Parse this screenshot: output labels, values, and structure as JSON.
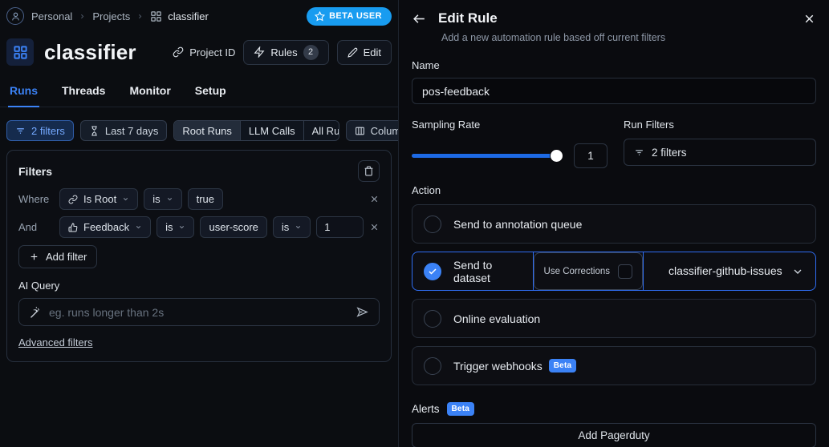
{
  "breadcrumb": {
    "personal": "Personal",
    "projects": "Projects",
    "project": "classifier",
    "beta_badge": "BETA USER"
  },
  "header": {
    "title": "classifier",
    "project_id": "Project ID",
    "rules": "Rules",
    "rules_count": "2",
    "edit": "Edit"
  },
  "tabs": {
    "runs": "Runs",
    "threads": "Threads",
    "monitor": "Monitor",
    "setup": "Setup"
  },
  "toolbar": {
    "filters": "2 filters",
    "date_range": "Last 7 days",
    "seg_root": "Root Runs",
    "seg_llm": "LLM Calls",
    "seg_all": "All Runs",
    "columns": "Columns"
  },
  "filters_panel": {
    "title": "Filters",
    "row1": {
      "conjunction": "Where",
      "field": "Is Root",
      "op": "is",
      "value": "true"
    },
    "row2": {
      "conjunction": "And",
      "field": "Feedback",
      "op1": "is",
      "key": "user-score",
      "op2": "is",
      "value": "1"
    },
    "add_filter": "Add filter",
    "ai_query_label": "AI Query",
    "ai_query_placeholder": "eg. runs longer than 2s",
    "advanced_filters": "Advanced filters"
  },
  "drawer": {
    "title": "Edit Rule",
    "subtitle": "Add a new automation rule based off current filters",
    "name_label": "Name",
    "name_value": "pos-feedback",
    "sampling_rate_label": "Sampling Rate",
    "sampling_rate_value": "1",
    "run_filters_label": "Run Filters",
    "run_filters_value": "2 filters",
    "action_label": "Action",
    "options": {
      "annotation": "Send to annotation queue",
      "dataset": "Send to dataset",
      "use_corrections": "Use Corrections",
      "dataset_value": "classifier-github-issues",
      "online_eval": "Online evaluation",
      "webhooks": "Trigger webhooks",
      "webhooks_beta": "Beta"
    },
    "alerts_label": "Alerts",
    "alerts_beta": "Beta",
    "add_pagerduty": "Add Pagerduty"
  },
  "colors": {
    "accent": "#3b82f6",
    "beta_user_badge": "#189cf0"
  }
}
